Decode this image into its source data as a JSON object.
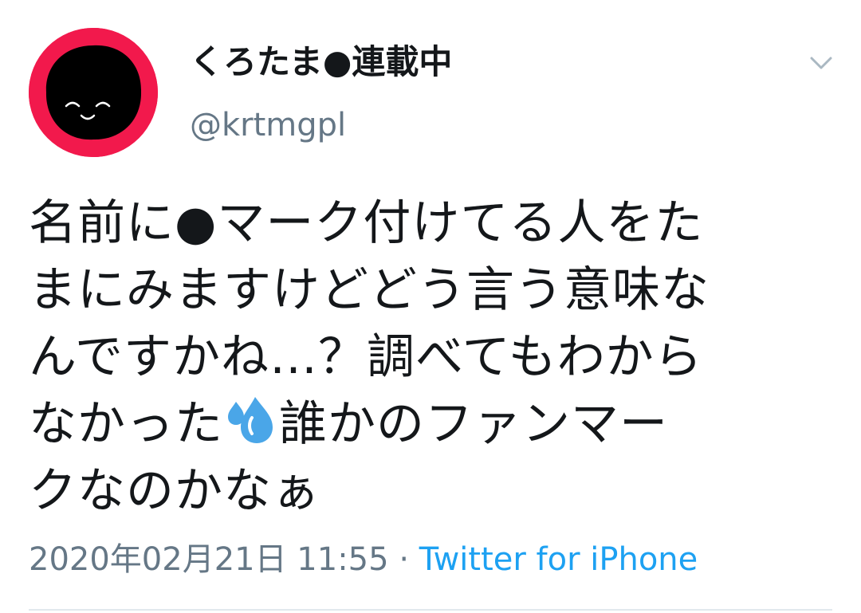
{
  "tweet": {
    "display_name": "くろたま●連載中",
    "handle": "@krtmgpl",
    "text_lines": [
      "名前に●マーク付けてる人をた",
      "まにみますけどどう言う意味な",
      "んですかね…？調べてもわから",
      "なかった",
      "誰かのファンマー",
      "クなのかなぁ"
    ],
    "emoji": "sweat-droplets-icon",
    "timestamp": "2020年02月21日 11:55",
    "separator": "·",
    "source": "Twitter for iPhone"
  },
  "colors": {
    "avatar_ring": "#f2194c",
    "avatar_face": "#000000",
    "name_text": "#14171a",
    "secondary_text": "#657786",
    "link": "#1da1f2",
    "divider": "#e1e8ed",
    "emoji_blue": "#4aa6e8"
  },
  "icons": {
    "menu": "chevron-down-icon",
    "emoji": "sweat-droplets-icon"
  }
}
